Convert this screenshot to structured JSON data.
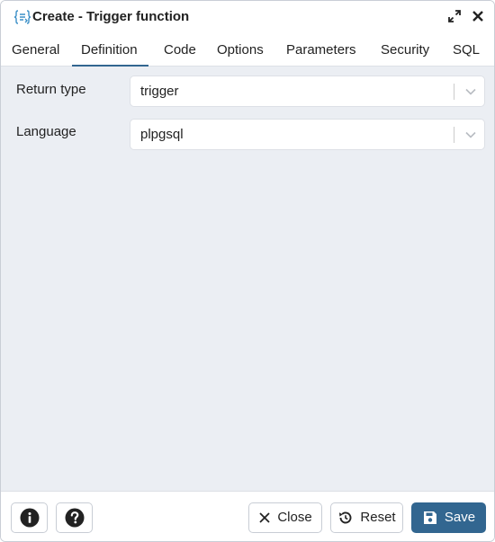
{
  "dialog": {
    "title": "Create - Trigger function",
    "icon": "trigger-function-icon"
  },
  "tabs": [
    {
      "label": "General",
      "active": false
    },
    {
      "label": "Definition",
      "active": true
    },
    {
      "label": "Code",
      "active": false
    },
    {
      "label": "Options",
      "active": false
    },
    {
      "label": "Parameters",
      "active": false
    },
    {
      "label": "Security",
      "active": false
    },
    {
      "label": "SQL",
      "active": false
    }
  ],
  "form": {
    "return_type": {
      "label": "Return type",
      "value": "trigger"
    },
    "language": {
      "label": "Language",
      "value": "plpgsql"
    }
  },
  "footer": {
    "info_icon": "info-icon",
    "help_icon": "help-icon",
    "close_label": "Close",
    "reset_label": "Reset",
    "save_label": "Save"
  },
  "colors": {
    "accent": "#326690",
    "body_background": "#ebeef3",
    "border": "#dde0e6"
  }
}
